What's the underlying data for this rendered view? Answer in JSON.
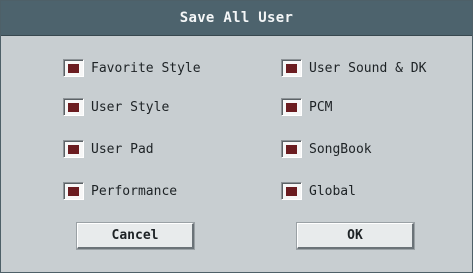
{
  "dialog": {
    "title": "Save All User",
    "options_left": [
      {
        "label": "Favorite Style",
        "checked": true
      },
      {
        "label": "User Style",
        "checked": true
      },
      {
        "label": "User Pad",
        "checked": true
      },
      {
        "label": "Performance",
        "checked": true
      }
    ],
    "options_right": [
      {
        "label": "User Sound & DK",
        "checked": true
      },
      {
        "label": "PCM",
        "checked": true
      },
      {
        "label": "SongBook",
        "checked": true
      },
      {
        "label": "Global",
        "checked": true
      }
    ],
    "buttons": {
      "cancel_label": "Cancel",
      "ok_label": "OK"
    }
  }
}
